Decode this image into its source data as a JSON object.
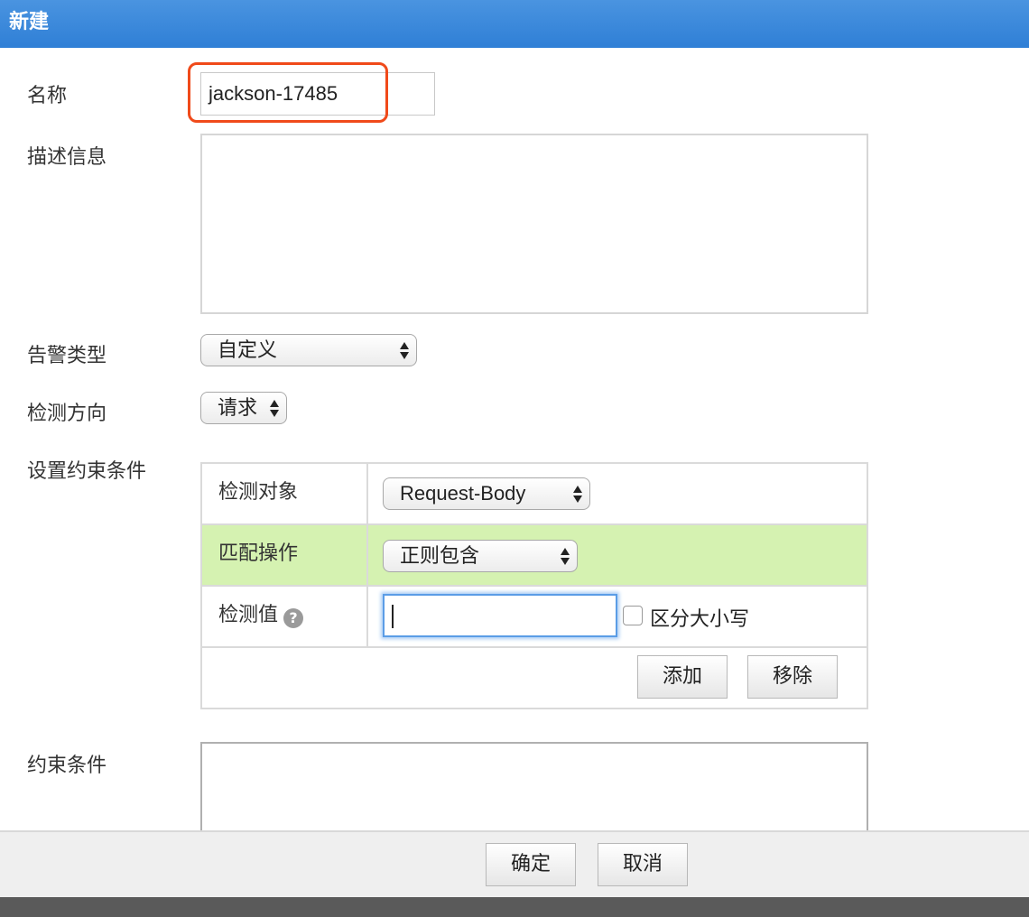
{
  "dialog": {
    "title": "新建"
  },
  "form": {
    "name_label": "名称",
    "name_value": "jackson-17485",
    "description_label": "描述信息",
    "alert_type_label": "告警类型",
    "alert_type_value": "自定义",
    "direction_label": "检测方向",
    "direction_value": "请求",
    "constraints_setup_label": "设置约束条件",
    "constraints_label": "约束条件"
  },
  "constraint_table": {
    "object_label": "检测对象",
    "object_value": "Request-Body",
    "match_label": "匹配操作",
    "match_value": "正则包含",
    "value_label": "检测值",
    "help_icon_glyph": "?",
    "case_sensitive_label": "区分大小写",
    "add_button": "添加",
    "remove_button": "移除"
  },
  "footer": {
    "confirm_button": "确定",
    "cancel_button": "取消"
  },
  "colors": {
    "title_bar": "#3a86da",
    "highlight_border": "#f04a1a",
    "match_row_bg": "#d5f2b1",
    "focus_border": "#5b9de6"
  },
  "icons": {
    "help": "help-icon",
    "select_arrows": "updown-arrows-icon"
  }
}
